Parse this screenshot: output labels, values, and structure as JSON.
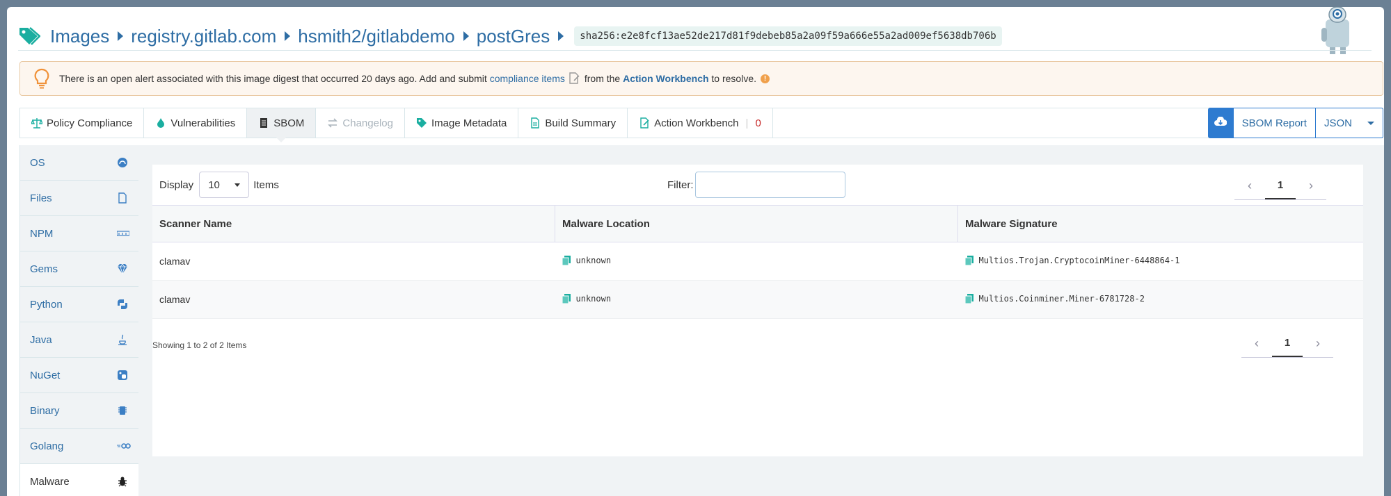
{
  "breadcrumb": {
    "images": "Images",
    "registry": "registry.gitlab.com",
    "repo": "hsmith2/gitlabdemo",
    "tag": "postGres",
    "digest": "sha256:e2e8fcf13ae52de217d81f9debeb85a2a09f59a666e55a2ad009ef5638db706b"
  },
  "alert": {
    "text_before": "There is an open alert associated with this image digest that occurred 20 days ago. Add and submit",
    "compliance_link": "compliance items",
    "text_middle": "from the",
    "workbench_link": "Action Workbench",
    "text_after": "to resolve."
  },
  "tabs": [
    {
      "label": "Policy Compliance",
      "icon": "balance-scale-icon"
    },
    {
      "label": "Vulnerabilities",
      "icon": "flame-icon"
    },
    {
      "label": "SBOM",
      "icon": "document-icon",
      "active": true
    },
    {
      "label": "Changelog",
      "icon": "exchange-icon",
      "disabled": true
    },
    {
      "label": "Image Metadata",
      "icon": "tag-icon"
    },
    {
      "label": "Build Summary",
      "icon": "file-icon"
    },
    {
      "label": "Action Workbench",
      "icon": "edit-file-icon",
      "count": "0"
    }
  ],
  "report": {
    "sbom_report": "SBOM Report",
    "format": "JSON"
  },
  "sidebar": {
    "items": [
      {
        "label": "OS",
        "icon": "os-icon"
      },
      {
        "label": "Files",
        "icon": "file-icon"
      },
      {
        "label": "NPM",
        "icon": "npm-icon"
      },
      {
        "label": "Gems",
        "icon": "gem-icon"
      },
      {
        "label": "Python",
        "icon": "python-icon"
      },
      {
        "label": "Java",
        "icon": "java-icon"
      },
      {
        "label": "NuGet",
        "icon": "nuget-icon"
      },
      {
        "label": "Binary",
        "icon": "chip-icon"
      },
      {
        "label": "Golang",
        "icon": "golang-icon"
      },
      {
        "label": "Malware",
        "icon": "bug-icon",
        "active": true
      }
    ]
  },
  "table_controls": {
    "display_label": "Display",
    "page_size": "10",
    "items_label": "Items",
    "filter_label": "Filter:",
    "filter_value": ""
  },
  "table": {
    "columns": [
      "Scanner Name",
      "Malware Location",
      "Malware Signature"
    ],
    "rows": [
      {
        "scanner": "clamav",
        "location": "unknown",
        "signature": "Multios.Trojan.CryptocoinMiner-6448864-1"
      },
      {
        "scanner": "clamav",
        "location": "unknown",
        "signature": "Multios.Coinminer.Miner-6781728-2"
      }
    ]
  },
  "pagination": {
    "current_page": "1",
    "showing": "Showing 1 to 2 of 2 Items"
  },
  "colors": {
    "accent": "#2e6da4",
    "teal": "#1aaea0",
    "alert_bg": "#fdf6ef",
    "badge_red": "#c62828"
  }
}
